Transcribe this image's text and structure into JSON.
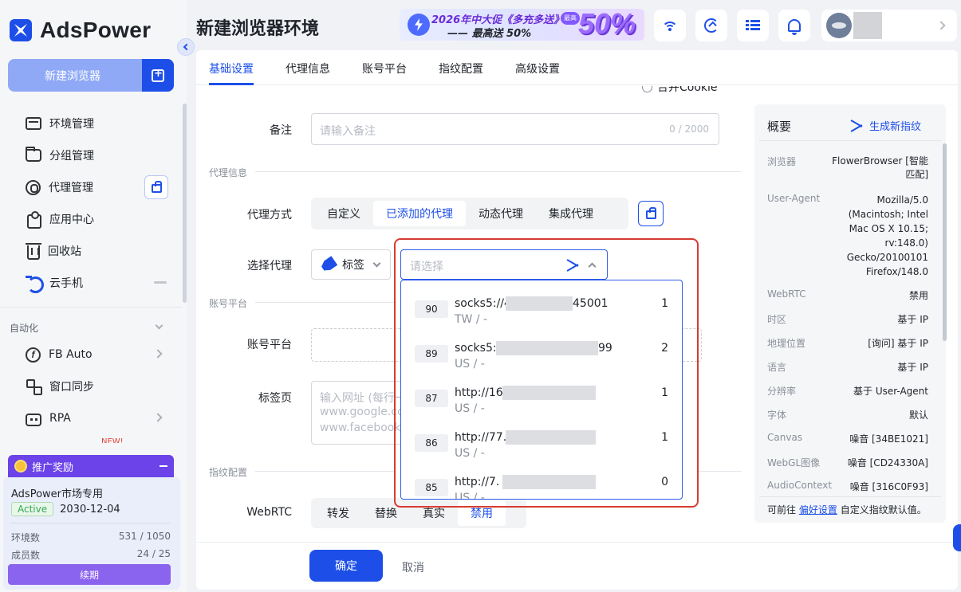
{
  "brand": {
    "name": "AdsPower"
  },
  "sidebar": {
    "new_browser_label": "新建浏览器",
    "items": [
      {
        "label": "环境管理"
      },
      {
        "label": "分组管理"
      },
      {
        "label": "代理管理"
      },
      {
        "label": "应用中心"
      },
      {
        "label": "回收站"
      },
      {
        "label": "云手机"
      }
    ],
    "automation": {
      "title": "自动化",
      "items": [
        {
          "label": "FB Auto"
        },
        {
          "label": "窗口同步"
        },
        {
          "label": "RPA"
        }
      ],
      "new_tag": "NEW!"
    },
    "promo": {
      "title": "推广奖励",
      "plan": "AdsPower市场专用",
      "status": "Active",
      "expiry": "2030-12-04",
      "env_label": "环境数",
      "env_value": "531 / 1050",
      "member_label": "成员数",
      "member_value": "24 / 25",
      "renew_label": "续期"
    }
  },
  "header": {
    "title": "新建浏览器环境",
    "banner": {
      "line1": "2026年中大促《多充多送》",
      "line2": "—— 最高送 50%",
      "tag": "最高",
      "big": "50%"
    }
  },
  "tabs": [
    {
      "label": "基础设置"
    },
    {
      "label": "代理信息"
    },
    {
      "label": "账号平台"
    },
    {
      "label": "指纹配置"
    },
    {
      "label": "高级设置"
    }
  ],
  "form": {
    "merge_cookie": "合并Cookie",
    "remark_label": "备注",
    "remark_placeholder": "请输入备注",
    "remark_count": "0 / 2000",
    "proxy_section": "代理信息",
    "proxy_mode_label": "代理方式",
    "proxy_modes": [
      "自定义",
      "已添加的代理",
      "动态代理",
      "集成代理"
    ],
    "proxy_mode_selected": "已添加的代理",
    "select_proxy_label": "选择代理",
    "tag_filter": "标签",
    "select_placeholder": "请选择",
    "account_section": "账号平台",
    "account_label": "账号平台",
    "tabs_label": "标签页",
    "tabs_placeholder_1": "输入网址 (每行一",
    "tabs_placeholder_2": "www.google.co",
    "tabs_placeholder_3": "www.facebook.",
    "fingerprint_section": "指纹配置",
    "webrtc_label": "WebRTC",
    "webrtc_options": [
      "转发",
      "替换",
      "真实",
      "禁用"
    ],
    "webrtc_selected": "禁用"
  },
  "proxy_options": [
    {
      "id": "90",
      "address_start": "socks5://4",
      "address_end": "45001",
      "location": "TW / -",
      "count": "1"
    },
    {
      "id": "89",
      "address_start": "socks5:/",
      "address_end": "99",
      "location": "US / -",
      "count": "2"
    },
    {
      "id": "87",
      "address_start": "http://16",
      "address_end": "",
      "location": "US / -",
      "count": "1"
    },
    {
      "id": "86",
      "address_start": "http://77.",
      "address_end": "",
      "location": "US / -",
      "count": "1"
    },
    {
      "id": "85",
      "address_start": "http://7.",
      "address_end": "",
      "location": "US / -",
      "count": "0"
    }
  ],
  "summary": {
    "title": "概要",
    "regen_label": "生成新指纹",
    "rows": [
      {
        "key": "浏览器",
        "value": "FlowerBrowser [智能匹配]"
      },
      {
        "key": "User-Agent",
        "value": "Mozilla/5.0 (Macintosh; Intel Mac OS X 10.15; rv:148.0) Gecko/20100101 Firefox/148.0"
      },
      {
        "key": "WebRTC",
        "value": "禁用"
      },
      {
        "key": "时区",
        "value": "基于 IP"
      },
      {
        "key": "地理位置",
        "value": "[询问] 基于 IP"
      },
      {
        "key": "语言",
        "value": "基于 IP"
      },
      {
        "key": "分辨率",
        "value": "基于 User-Agent"
      },
      {
        "key": "字体",
        "value": "默认"
      },
      {
        "key": "Canvas",
        "value": "噪音 [34BE1021]"
      },
      {
        "key": "WebGL图像",
        "value": "噪音 [CD24330A]"
      },
      {
        "key": "AudioContext",
        "value": "噪音 [316C0F93]"
      }
    ],
    "footer_pre": "可前往",
    "footer_link": "偏好设置",
    "footer_post": "自定义指纹默认值。"
  },
  "actions": {
    "confirm": "确定",
    "cancel": "取消"
  },
  "colors": {
    "primary": "#1d4fe8",
    "highlight_border": "#d63c2f",
    "promo": "#6b43e8"
  }
}
